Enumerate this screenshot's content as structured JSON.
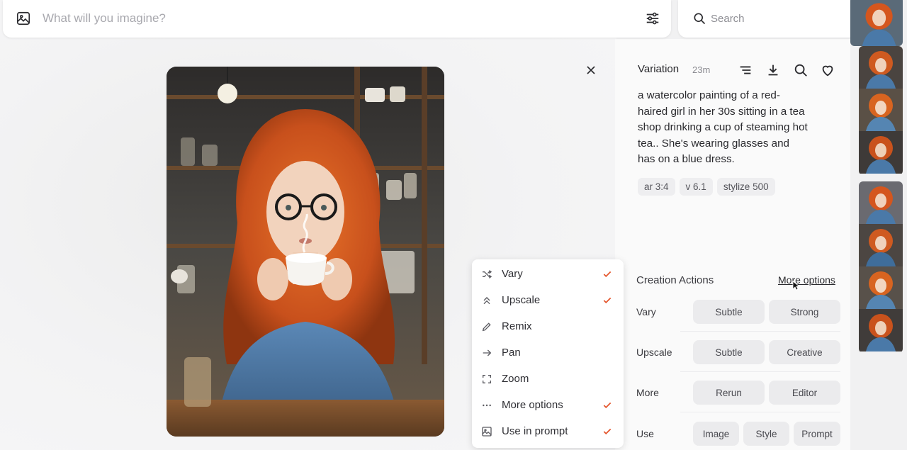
{
  "prompt_bar": {
    "placeholder": "What will you imagine?"
  },
  "search": {
    "placeholder": "Search"
  },
  "detail": {
    "title": "Variation",
    "time": "23m",
    "prompt": "a watercolor painting of a red-haired girl in her 30s sitting in a tea shop drinking a cup of steaming hot tea.. She's wearing glasses and has on a blue dress.",
    "tags": [
      "ar 3:4",
      "v 6.1",
      "stylize 500"
    ]
  },
  "creation_actions": {
    "title": "Creation Actions",
    "more_options": "More options",
    "rows": [
      {
        "label": "Vary",
        "buttons": [
          "Subtle",
          "Strong"
        ]
      },
      {
        "label": "Upscale",
        "buttons": [
          "Subtle",
          "Creative"
        ]
      },
      {
        "label": "More",
        "buttons": [
          "Rerun",
          "Editor"
        ]
      },
      {
        "label": "Use",
        "buttons": [
          "Image",
          "Style",
          "Prompt"
        ]
      }
    ]
  },
  "menu": {
    "items": [
      {
        "label": "Vary",
        "icon": "shuffle-icon",
        "checked": true
      },
      {
        "label": "Upscale",
        "icon": "double-chevron-up-icon",
        "checked": true
      },
      {
        "label": "Remix",
        "icon": "pencil-icon",
        "checked": false
      },
      {
        "label": "Pan",
        "icon": "arrow-right-icon",
        "checked": false
      },
      {
        "label": "Zoom",
        "icon": "expand-icon",
        "checked": false
      },
      {
        "label": "More options",
        "icon": "ellipsis-icon",
        "checked": true
      },
      {
        "label": "Use in prompt",
        "icon": "image-plus-icon",
        "checked": true
      }
    ]
  },
  "colors": {
    "accent": "#e4572e",
    "hair": "#d4561e",
    "dress": "#4a79a8"
  }
}
